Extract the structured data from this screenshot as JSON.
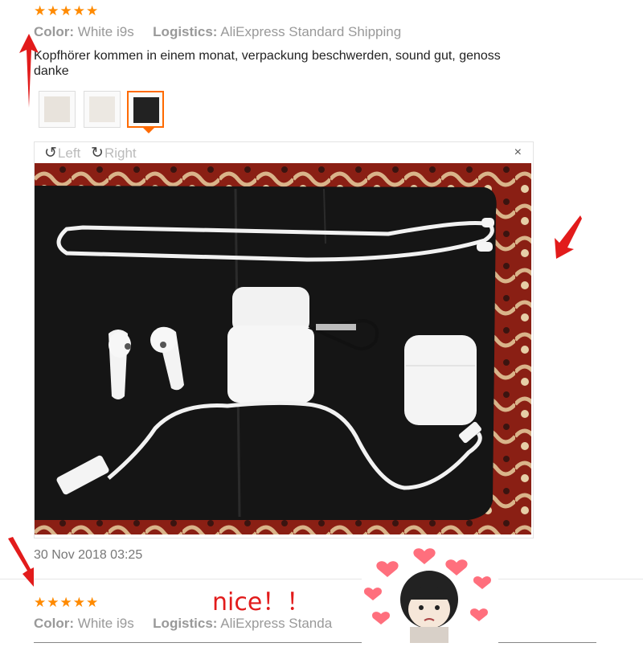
{
  "review1": {
    "stars": "★★★★★",
    "color_label": "Color:",
    "color_value": "White i9s",
    "logistics_label": "Logistics:",
    "logistics_value": "AliExpress Standard Shipping",
    "text_line1": "Kopfhörer kommen in einem monat, verpackung beschwerden, sound gut, genoss",
    "text_line2": "danke",
    "date": "30 Nov 2018 03:25"
  },
  "viewer": {
    "left_label": "Left",
    "right_label": "Right",
    "close_label": "×",
    "rotate_left_icon": "rotate-left-icon",
    "rotate_right_icon": "rotate-right-icon"
  },
  "overlay": {
    "caption": "nice！！"
  },
  "review2": {
    "stars": "★★★★★",
    "color_label": "Color:",
    "color_value": "White i9s",
    "logistics_label": "Logistics:",
    "logistics_value": "AliExpress Standa"
  },
  "colors": {
    "star": "#ff8a00",
    "accent": "#ff6a00",
    "annotation_red": "#e21b1b"
  }
}
